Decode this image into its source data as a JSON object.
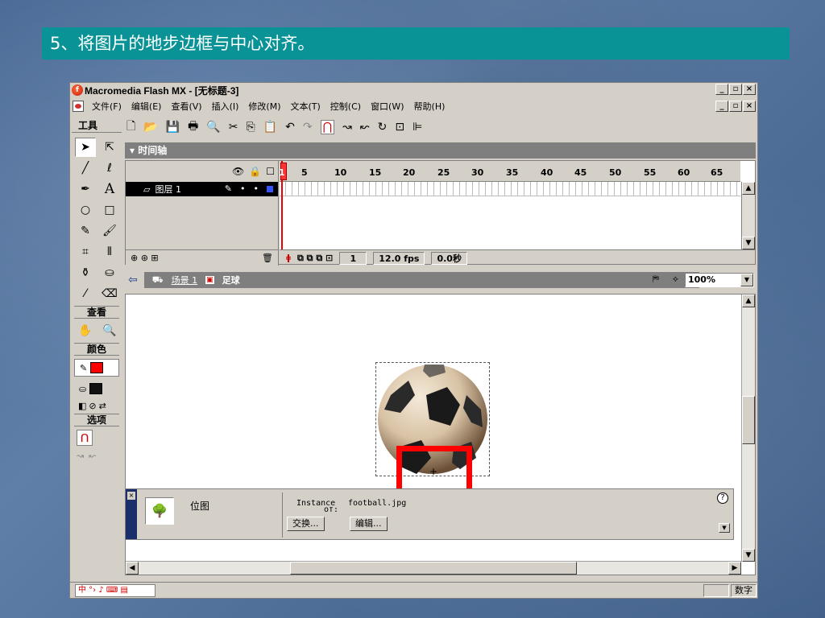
{
  "slide": {
    "title": "5、将图片的地步边框与中心对齐。"
  },
  "window": {
    "title": "Macromedia Flash MX - [无标题-3]"
  },
  "menu": [
    "文件(F)",
    "编辑(E)",
    "查看(V)",
    "插入(I)",
    "修改(M)",
    "文本(T)",
    "控制(C)",
    "窗口(W)",
    "帮助(H)"
  ],
  "tools": {
    "header": "工具",
    "view_label": "查看",
    "color_label": "颜色",
    "options_label": "选项"
  },
  "timeline": {
    "header": "时间轴",
    "layer_name": "图层 1",
    "ruler": [
      "1",
      "5",
      "10",
      "15",
      "20",
      "25",
      "30",
      "35",
      "40",
      "45",
      "50",
      "55",
      "60",
      "65"
    ],
    "current_frame": "1",
    "fps": "12.0 fps",
    "time": "0.0秒"
  },
  "scene": {
    "scene_name": "场景 1",
    "symbol_name": "足球",
    "zoom": "100%"
  },
  "properties": {
    "type_label": "位图",
    "instance_label": "Instance",
    "instance_of": "of:",
    "file_name": "football.jpg",
    "swap_button": "交换...",
    "edit_button": "编辑..."
  },
  "status": {
    "mode": "数字"
  },
  "colors": {
    "title_bg": "#0a9396",
    "highlight": "#ff0000",
    "fill_swatch": "#ff0000"
  }
}
